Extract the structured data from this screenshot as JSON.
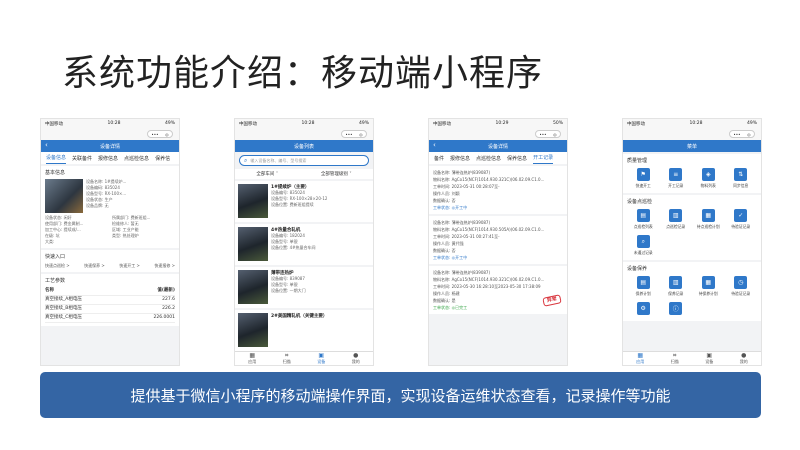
{
  "slide": {
    "title": "系统功能介绍：移动端小程序",
    "banner": "提供基于微信小程序的移动端操作界面，实现设备运维状态查看，记录操作等功能"
  },
  "colors": {
    "accent": "#2f78c9",
    "banner": "#3465a4",
    "stamp": "#d9363e",
    "done": "#3aa64a"
  },
  "status_bar": {
    "carrier": "中国移动",
    "time_a": "10:28",
    "time_c": "10:29",
    "battery_a": "49%",
    "battery_c": "50%"
  },
  "wx_capsule": {
    "more": "•••",
    "close": "◎"
  },
  "phone1": {
    "nav_title": "设备详情",
    "tabs": [
      "设备信息",
      "关联备件",
      "报修信息",
      "点巡检信息",
      "保养信"
    ],
    "basic_title": "基本信息",
    "kv_right": [
      "设备名称: 1#提续炉...",
      "设备编码: 835024",
      "设备型号: RX-100×...",
      "设备状态: 生产",
      "设备品牌: 无"
    ],
    "kv_grid": [
      "设备状态: 闲好",
      "所属部门: 费新班组...",
      "使用部门: 费金属制...",
      "检维修人: 暂无",
      "加工中心: 提续成/...",
      "区域: 工业产能",
      "在级: 坑",
      "类型: 热处理炉",
      "大类: "
    ],
    "quick_title": "快速入口",
    "quick": [
      "快速点巡检 >",
      "快速保养 >",
      "快速开工 >",
      "快速报修 >"
    ],
    "params_title": "工艺参数",
    "params_head": [
      "名称",
      "值(最新)"
    ],
    "params": [
      {
        "name": "真空接续_A相电压",
        "value": "227.6"
      },
      {
        "name": "真空接续_B相电压",
        "value": "226.2"
      },
      {
        "name": "真空接续_C相电压",
        "value": "226.0001"
      }
    ]
  },
  "phone2": {
    "nav_title": "设备列表",
    "search_placeholder": "输入设备名称、编号、型号搜索",
    "filter_a": "全部车间 ˅",
    "filter_b": "全部管理级别 ˅",
    "devices": [
      {
        "name": "1#提续炉（主要）",
        "code": "设备编号: 835024",
        "model": "设备型号: RX-100×28×20-12",
        "loc": "设备位置: 费新班组提续"
      },
      {
        "name": "4#热量合轧机",
        "code": "设备编号: 182024",
        "model": "设备型号: 单银",
        "loc": "设备位置: 4#热量合车间"
      },
      {
        "name": "薄带连热炉",
        "code": "设备编号: 839087",
        "model": "设备型号: 单银",
        "loc": "设备位置: 一期大门"
      },
      {
        "name": "2#美国精轧机（关键主要）",
        "code": "",
        "model": "",
        "loc": ""
      }
    ]
  },
  "phone3": {
    "nav_title": "设备详情",
    "tabs": [
      "备件",
      "报修信息",
      "点巡检信息",
      "保养信息",
      "开工记录"
    ],
    "records": [
      {
        "device": "设备名称: 薄带连热炉(839087)",
        "mat": "物料名称: AgCo15(NCF(1014.930.321C)(06.02.09.C1.0...",
        "time": "工单时间: 2023-05-31 00:28:07至-",
        "op": "操作人员: 刘颖",
        "confirm": "数据确认: 否",
        "status": "工单状态: ◎开工中",
        "status_class": "ok"
      },
      {
        "device": "设备名称: 薄带连热炉(839087)",
        "mat": "物料名称: AgCo15(NCF(1014.930.505A)(06.02.09.C1.0...",
        "time": "工单时间: 2023-05-31 00:27:41至-",
        "op": "操作人员: 黄代强",
        "confirm": "数据确认: 否",
        "status": "工单状态: ◎开工中",
        "status_class": "ok"
      },
      {
        "device": "设备名称: 薄带连热炉(839087)",
        "mat": "物料名称: AgCo15(NCF(1014.930.321C)(06.02.09.C1.0...",
        "time": "工单时间: 2023-05-30 16:28:10至2023-05-30 17:38:09",
        "op": "操作人员: 杨建",
        "confirm": "数据确认: 是",
        "status": "工单状态: ◎已完工",
        "status_class": "done"
      }
    ],
    "stamp": "异常"
  },
  "phone4": {
    "nav_title": "菜单",
    "groups": [
      {
        "title": "质量管理",
        "items": [
          "快速开工",
          "开工记录",
          "物料列表",
          "同步信息"
        ]
      },
      {
        "title": "设备点巡检",
        "items": [
          "点巡检列表",
          "点巡检记录",
          "待点巡检计划",
          "待验证记录",
          "未通过记录"
        ]
      },
      {
        "title": "设备保养",
        "items": [
          "保养计划",
          "保养记录",
          "待保养计划",
          "待验证记录",
          "",
          ""
        ]
      }
    ]
  },
  "bottom_nav": [
    "应用",
    "扫描",
    "设备",
    "我的"
  ]
}
